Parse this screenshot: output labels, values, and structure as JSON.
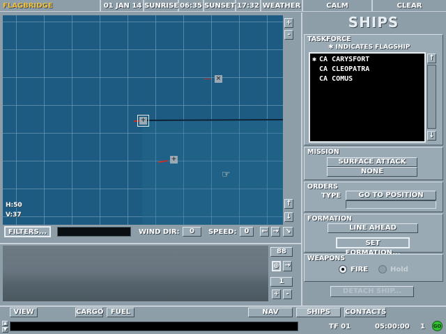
{
  "topbar": {
    "app_title": "FLAGBRIDGE",
    "date": "01 JAN 14",
    "sunrise_label": "SUNRISE",
    "sunrise_time": "06:35",
    "sunset_label": "SUNSET",
    "sunset_time": "17:32",
    "weather_label": "WEATHER",
    "sea": "CALM",
    "sky": "CLEAR"
  },
  "map": {
    "h_readout": "H:50",
    "v_readout": "V:37",
    "zoom_in": "+",
    "zoom_out": "-",
    "scroll_up": "↑",
    "scroll_down": "↓"
  },
  "map_controls": {
    "filters_label": "FILTERS...",
    "wind_dir_label": "WIND DIR:",
    "wind_dir_value": "0",
    "speed_label": "SPEED:",
    "speed_value": "0"
  },
  "viewer": {
    "count_top": "88",
    "count_bottom": "1"
  },
  "ships_panel": {
    "header": "SHIPS",
    "taskforce_label": "TASKFORCE",
    "flagship_note": "✱ INDICATES FLAGSHIP",
    "ships": [
      {
        "flag": "✱",
        "name": "CA CARYSFORT"
      },
      {
        "flag": "",
        "name": "CA CLEOPATRA"
      },
      {
        "flag": "",
        "name": "CA COMUS"
      }
    ],
    "mission_label": "MISSION",
    "mission_primary": "SURFACE ATTACK",
    "mission_secondary": "NONE",
    "orders_label": "ORDERS",
    "type_label": "TYPE",
    "order_type": "GO TO POSITION",
    "formation_label": "FORMATION",
    "formation_value": "LINE AHEAD",
    "set_formation": "SET FORMATION...",
    "weapons_label": "WEAPONS",
    "fire_label": "FIRE",
    "hold_label": "Hold",
    "weapons_selected": "FIRE",
    "detach_ship": "DETACH SHIP..."
  },
  "bottom_tabs": {
    "view": "VIEW",
    "cargo": "CARGO",
    "fuel": "FUEL",
    "nav": "NAV",
    "ships": "SHIPS",
    "contacts": "CONTACTS"
  },
  "status_bar": {
    "tf": "TF 01",
    "time": "05:00:00",
    "speed_mult": "1",
    "go": "GO"
  },
  "colors": {
    "sea": "#1d5b82",
    "panel": "#8e9ea9",
    "title_accent": "#f0c040",
    "go_button": "#2fbf2f"
  }
}
